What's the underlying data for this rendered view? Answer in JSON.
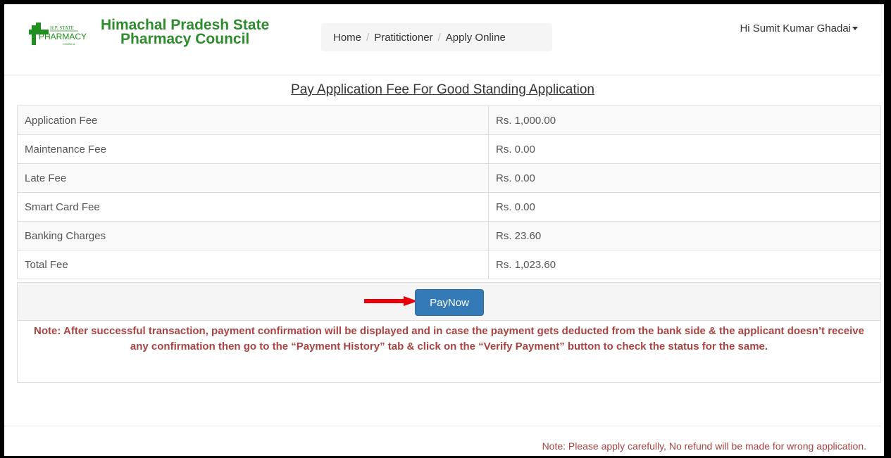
{
  "header": {
    "logo_text": "H.P. STATE PHARMACY COUNCIL",
    "brand_line1": "Himachal Pradesh State",
    "brand_line2": "Pharmacy Council",
    "breadcrumb": [
      "Home",
      "Pratitictioner",
      "Apply Online"
    ],
    "user_greeting": "Hi Sumit Kumar Ghadai"
  },
  "page": {
    "title": "Pay Application Fee For Good Standing Application"
  },
  "fees": [
    {
      "label": "Application Fee",
      "value": "Rs. 1,000.00"
    },
    {
      "label": "Maintenance Fee",
      "value": "Rs. 0.00"
    },
    {
      "label": "Late Fee",
      "value": "Rs. 0.00"
    },
    {
      "label": "Smart Card Fee",
      "value": "Rs. 0.00"
    },
    {
      "label": "Banking Charges",
      "value": "Rs. 23.60"
    },
    {
      "label": "Total Fee",
      "value": "Rs. 1,023.60"
    }
  ],
  "actions": {
    "pay_label": "PayNow"
  },
  "note": "Note: After successful transaction, payment confirmation will be displayed and in case the payment gets deducted from the bank side & the applicant doesn’t receive any confirmation then go to the “Payment History” tab & click on the “Verify Payment” button to check the status for the same.",
  "footer_note": "Note: Please apply carefully, No refund will be made for wrong application.",
  "colors": {
    "brand_green": "#2e8b2e",
    "primary_button": "#337ab7",
    "note_red": "#a94442",
    "arrow_red": "#e8000b"
  }
}
